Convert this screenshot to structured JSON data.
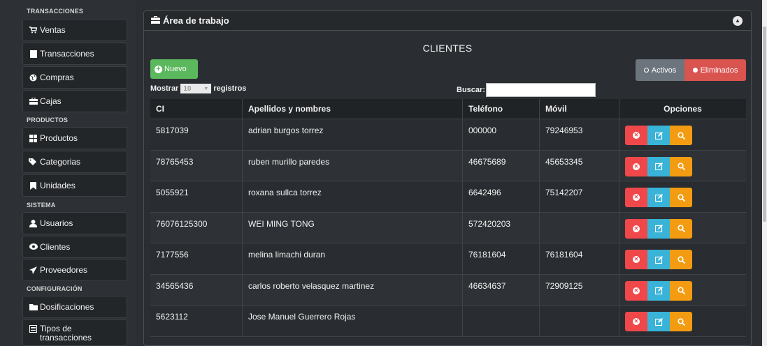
{
  "sidebar": {
    "sections": [
      {
        "header": "TRANSACCIONES",
        "items": [
          {
            "label": "Ventas",
            "icon": "cart-icon"
          },
          {
            "label": "Transacciones",
            "icon": "file-icon"
          },
          {
            "label": "Compras",
            "icon": "globe-icon"
          },
          {
            "label": "Cajas",
            "icon": "briefcase-icon"
          }
        ]
      },
      {
        "header": "PRODUCTOS",
        "items": [
          {
            "label": "Productos",
            "icon": "cubes-icon"
          },
          {
            "label": "Categorias",
            "icon": "tags-icon"
          },
          {
            "label": "Unidades",
            "icon": "bookmark-icon"
          }
        ]
      },
      {
        "header": "SISTEMA",
        "items": [
          {
            "label": "Usuarios",
            "icon": "user-icon"
          },
          {
            "label": "Clientes",
            "icon": "eye-icon"
          },
          {
            "label": "Proveedores",
            "icon": "paper-plane-icon"
          }
        ]
      },
      {
        "header": "CONFIGURACIÓN",
        "items": [
          {
            "label": "Dosificaciones",
            "icon": "folder-icon"
          },
          {
            "label": "Tipos de transacciones",
            "icon": "list-icon"
          }
        ]
      }
    ]
  },
  "panel": {
    "header": "Área de trabajo",
    "title": "CLIENTES",
    "new_button": "Nuevo",
    "active_button": "Activos",
    "deleted_button": "Eliminados",
    "show_label": "Mostrar",
    "show_value": "10",
    "records_label": "registros",
    "search_label": "Buscar:",
    "search_value": ""
  },
  "table": {
    "columns": [
      "CI",
      "Apellidos y nombres",
      "Teléfono",
      "Móvil",
      "Opciones"
    ],
    "rows": [
      [
        "5817039",
        "adrian burgos torrez",
        "000000",
        "79246953"
      ],
      [
        "78765453",
        "ruben murillo paredes",
        "46675689",
        "45653345"
      ],
      [
        "5055921",
        "roxana sullca torrez",
        "6642496",
        "75142207"
      ],
      [
        "76076125300",
        "WEI MING TONG",
        "572420203",
        ""
      ],
      [
        "7177556",
        "melina limachi duran",
        "76181604",
        "76181604"
      ],
      [
        "34565436",
        "carlos roberto velasquez martinez",
        "46634637",
        "72909125"
      ],
      [
        "5623112",
        "Jose Manuel Guerrero Rojas",
        "",
        ""
      ]
    ]
  },
  "colors": {
    "sidebar_bg": "#2d3135",
    "panel_bg": "#2a2e32",
    "new_green": "#5cb85c",
    "activos_gray": "#6c757d",
    "eliminados_red": "#d9534f",
    "delete_red": "#f0484a",
    "edit_blue": "#39b3d7",
    "view_orange": "#f39c12"
  }
}
